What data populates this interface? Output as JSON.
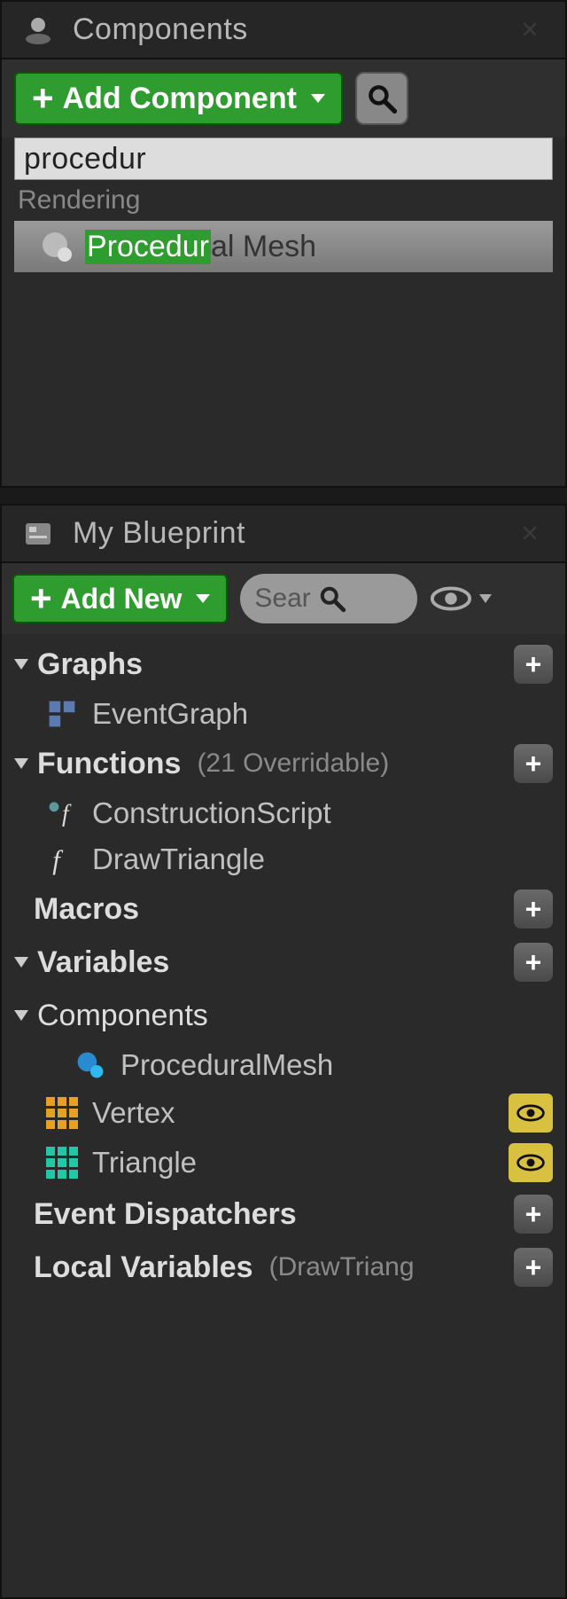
{
  "colors": {
    "accent_green": "#2f9c2f",
    "highlight": "#2f9c2f",
    "vertex_icon": "#e8a020",
    "triangle_icon": "#20c8a8"
  },
  "panels": {
    "components": {
      "title": "Components",
      "add_label": "Add Component",
      "search_value": "procedur",
      "category": "Rendering",
      "result": {
        "highlight": "Procedur",
        "rest": "al Mesh",
        "full": "Procedural Mesh"
      }
    },
    "myblueprint": {
      "title": "My Blueprint",
      "add_label": "Add New",
      "search_placeholder": "Sear",
      "sections": {
        "graphs": {
          "label": "Graphs",
          "items": [
            {
              "label": "EventGraph",
              "icon": "graph"
            }
          ]
        },
        "functions": {
          "label": "Functions",
          "sub": "(21 Overridable)",
          "items": [
            {
              "label": "ConstructionScript",
              "icon": "fn-special"
            },
            {
              "label": "DrawTriangle",
              "icon": "fn"
            }
          ]
        },
        "macros": {
          "label": "Macros"
        },
        "variables": {
          "label": "Variables"
        },
        "components_sub": {
          "label": "Components",
          "items": [
            {
              "label": "ProceduralMesh",
              "icon": "sphere",
              "eye": false
            },
            {
              "label": "Vertex",
              "icon": "grid-orange",
              "eye": true
            },
            {
              "label": "Triangle",
              "icon": "grid-teal",
              "eye": true
            }
          ]
        },
        "dispatchers": {
          "label": "Event Dispatchers"
        },
        "local_vars": {
          "label": "Local Variables",
          "sub": "(DrawTriang"
        }
      }
    }
  }
}
